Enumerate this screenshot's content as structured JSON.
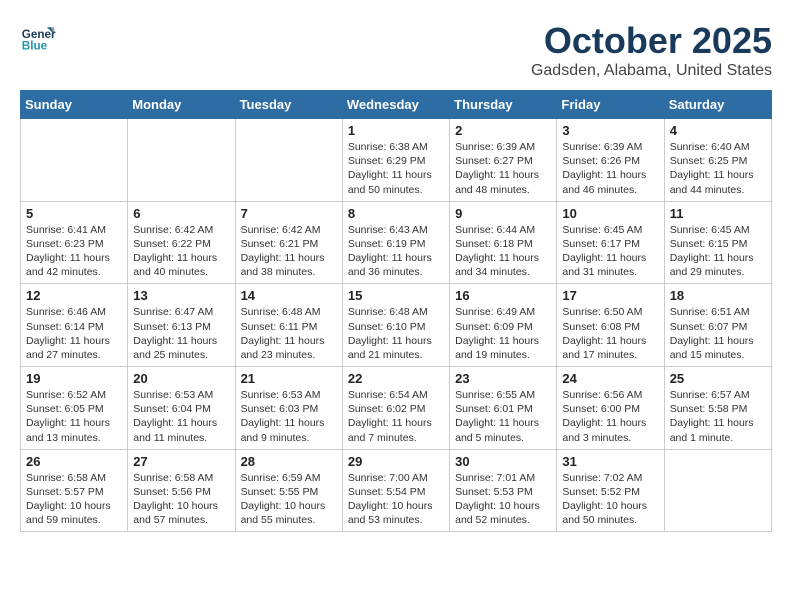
{
  "header": {
    "logo_line1": "General",
    "logo_line2": "Blue",
    "month": "October 2025",
    "location": "Gadsden, Alabama, United States"
  },
  "weekdays": [
    "Sunday",
    "Monday",
    "Tuesday",
    "Wednesday",
    "Thursday",
    "Friday",
    "Saturday"
  ],
  "weeks": [
    [
      {
        "day": "",
        "sunrise": "",
        "sunset": "",
        "daylight": ""
      },
      {
        "day": "",
        "sunrise": "",
        "sunset": "",
        "daylight": ""
      },
      {
        "day": "",
        "sunrise": "",
        "sunset": "",
        "daylight": ""
      },
      {
        "day": "1",
        "sunrise": "Sunrise: 6:38 AM",
        "sunset": "Sunset: 6:29 PM",
        "daylight": "Daylight: 11 hours and 50 minutes."
      },
      {
        "day": "2",
        "sunrise": "Sunrise: 6:39 AM",
        "sunset": "Sunset: 6:27 PM",
        "daylight": "Daylight: 11 hours and 48 minutes."
      },
      {
        "day": "3",
        "sunrise": "Sunrise: 6:39 AM",
        "sunset": "Sunset: 6:26 PM",
        "daylight": "Daylight: 11 hours and 46 minutes."
      },
      {
        "day": "4",
        "sunrise": "Sunrise: 6:40 AM",
        "sunset": "Sunset: 6:25 PM",
        "daylight": "Daylight: 11 hours and 44 minutes."
      }
    ],
    [
      {
        "day": "5",
        "sunrise": "Sunrise: 6:41 AM",
        "sunset": "Sunset: 6:23 PM",
        "daylight": "Daylight: 11 hours and 42 minutes."
      },
      {
        "day": "6",
        "sunrise": "Sunrise: 6:42 AM",
        "sunset": "Sunset: 6:22 PM",
        "daylight": "Daylight: 11 hours and 40 minutes."
      },
      {
        "day": "7",
        "sunrise": "Sunrise: 6:42 AM",
        "sunset": "Sunset: 6:21 PM",
        "daylight": "Daylight: 11 hours and 38 minutes."
      },
      {
        "day": "8",
        "sunrise": "Sunrise: 6:43 AM",
        "sunset": "Sunset: 6:19 PM",
        "daylight": "Daylight: 11 hours and 36 minutes."
      },
      {
        "day": "9",
        "sunrise": "Sunrise: 6:44 AM",
        "sunset": "Sunset: 6:18 PM",
        "daylight": "Daylight: 11 hours and 34 minutes."
      },
      {
        "day": "10",
        "sunrise": "Sunrise: 6:45 AM",
        "sunset": "Sunset: 6:17 PM",
        "daylight": "Daylight: 11 hours and 31 minutes."
      },
      {
        "day": "11",
        "sunrise": "Sunrise: 6:45 AM",
        "sunset": "Sunset: 6:15 PM",
        "daylight": "Daylight: 11 hours and 29 minutes."
      }
    ],
    [
      {
        "day": "12",
        "sunrise": "Sunrise: 6:46 AM",
        "sunset": "Sunset: 6:14 PM",
        "daylight": "Daylight: 11 hours and 27 minutes."
      },
      {
        "day": "13",
        "sunrise": "Sunrise: 6:47 AM",
        "sunset": "Sunset: 6:13 PM",
        "daylight": "Daylight: 11 hours and 25 minutes."
      },
      {
        "day": "14",
        "sunrise": "Sunrise: 6:48 AM",
        "sunset": "Sunset: 6:11 PM",
        "daylight": "Daylight: 11 hours and 23 minutes."
      },
      {
        "day": "15",
        "sunrise": "Sunrise: 6:48 AM",
        "sunset": "Sunset: 6:10 PM",
        "daylight": "Daylight: 11 hours and 21 minutes."
      },
      {
        "day": "16",
        "sunrise": "Sunrise: 6:49 AM",
        "sunset": "Sunset: 6:09 PM",
        "daylight": "Daylight: 11 hours and 19 minutes."
      },
      {
        "day": "17",
        "sunrise": "Sunrise: 6:50 AM",
        "sunset": "Sunset: 6:08 PM",
        "daylight": "Daylight: 11 hours and 17 minutes."
      },
      {
        "day": "18",
        "sunrise": "Sunrise: 6:51 AM",
        "sunset": "Sunset: 6:07 PM",
        "daylight": "Daylight: 11 hours and 15 minutes."
      }
    ],
    [
      {
        "day": "19",
        "sunrise": "Sunrise: 6:52 AM",
        "sunset": "Sunset: 6:05 PM",
        "daylight": "Daylight: 11 hours and 13 minutes."
      },
      {
        "day": "20",
        "sunrise": "Sunrise: 6:53 AM",
        "sunset": "Sunset: 6:04 PM",
        "daylight": "Daylight: 11 hours and 11 minutes."
      },
      {
        "day": "21",
        "sunrise": "Sunrise: 6:53 AM",
        "sunset": "Sunset: 6:03 PM",
        "daylight": "Daylight: 11 hours and 9 minutes."
      },
      {
        "day": "22",
        "sunrise": "Sunrise: 6:54 AM",
        "sunset": "Sunset: 6:02 PM",
        "daylight": "Daylight: 11 hours and 7 minutes."
      },
      {
        "day": "23",
        "sunrise": "Sunrise: 6:55 AM",
        "sunset": "Sunset: 6:01 PM",
        "daylight": "Daylight: 11 hours and 5 minutes."
      },
      {
        "day": "24",
        "sunrise": "Sunrise: 6:56 AM",
        "sunset": "Sunset: 6:00 PM",
        "daylight": "Daylight: 11 hours and 3 minutes."
      },
      {
        "day": "25",
        "sunrise": "Sunrise: 6:57 AM",
        "sunset": "Sunset: 5:58 PM",
        "daylight": "Daylight: 11 hours and 1 minute."
      }
    ],
    [
      {
        "day": "26",
        "sunrise": "Sunrise: 6:58 AM",
        "sunset": "Sunset: 5:57 PM",
        "daylight": "Daylight: 10 hours and 59 minutes."
      },
      {
        "day": "27",
        "sunrise": "Sunrise: 6:58 AM",
        "sunset": "Sunset: 5:56 PM",
        "daylight": "Daylight: 10 hours and 57 minutes."
      },
      {
        "day": "28",
        "sunrise": "Sunrise: 6:59 AM",
        "sunset": "Sunset: 5:55 PM",
        "daylight": "Daylight: 10 hours and 55 minutes."
      },
      {
        "day": "29",
        "sunrise": "Sunrise: 7:00 AM",
        "sunset": "Sunset: 5:54 PM",
        "daylight": "Daylight: 10 hours and 53 minutes."
      },
      {
        "day": "30",
        "sunrise": "Sunrise: 7:01 AM",
        "sunset": "Sunset: 5:53 PM",
        "daylight": "Daylight: 10 hours and 52 minutes."
      },
      {
        "day": "31",
        "sunrise": "Sunrise: 7:02 AM",
        "sunset": "Sunset: 5:52 PM",
        "daylight": "Daylight: 10 hours and 50 minutes."
      },
      {
        "day": "",
        "sunrise": "",
        "sunset": "",
        "daylight": ""
      }
    ]
  ]
}
